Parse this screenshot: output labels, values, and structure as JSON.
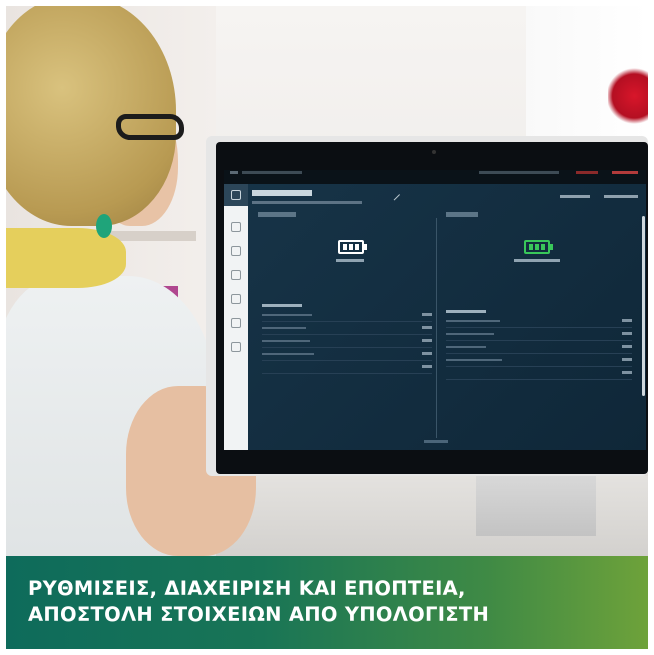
{
  "banner": {
    "line1": "ΡΥΘΜΙΣΕΙΣ, ΔΙΑΧΕΙΡΙΣΗ ΚΑΙ ΕΠΟΠΤΕΙΑ,",
    "line2": "ΑΠΟΣΤΟΛΗ ΣΤΟΙΧΕΙΩΝ ΑΠΟ ΥΠΟΛΟΓΙΣΤΗ"
  },
  "colors": {
    "banner_start": "#0e6b5b",
    "banner_end": "#6ea23a",
    "screen_bg": "#173448",
    "battery_left": "#ffffff",
    "battery_right": "#39c85a"
  },
  "screen": {
    "icons": [
      "battery-icon",
      "battery-icon"
    ]
  }
}
